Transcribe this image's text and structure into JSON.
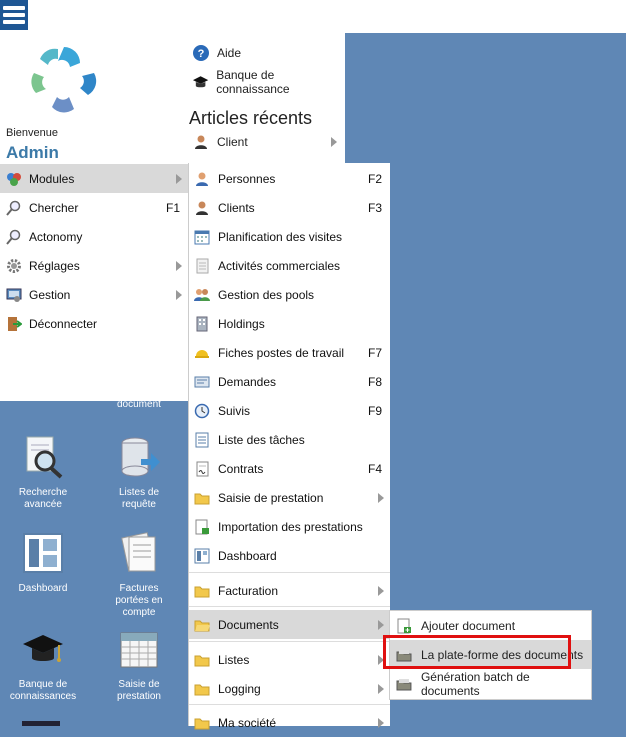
{
  "topbar": {
    "menu_icon": "hamburger-icon"
  },
  "desktop": {
    "partial_label": "document",
    "icons": [
      {
        "label": "Recherche avancée",
        "icon": "magnifier-document-icon"
      },
      {
        "label": "Listes de requête",
        "icon": "database-arrow-icon"
      },
      {
        "label": "Dashboard",
        "icon": "dashboard-icon"
      },
      {
        "label": "Factures portées en compte",
        "icon": "invoice-icon"
      },
      {
        "label": "Banque de connaissances",
        "icon": "graduation-cap-icon"
      },
      {
        "label": "Saisie de prestation",
        "icon": "calendar-icon"
      }
    ]
  },
  "main_menu": {
    "welcome": "Bienvenue",
    "user": "Admin",
    "help_label": "Aide",
    "knowledge_label": "Banque de connaissance",
    "recent_title": "Articles récents",
    "recent_items": [
      {
        "label": "Client"
      }
    ],
    "items": [
      {
        "label": "Modules",
        "icon": "modules-icon",
        "shortcut": "",
        "has_sub": true,
        "selected": true
      },
      {
        "label": "Chercher",
        "icon": "search-icon",
        "shortcut": "F1",
        "has_sub": false
      },
      {
        "label": "Actonomy",
        "icon": "search-icon",
        "shortcut": "",
        "has_sub": false
      },
      {
        "label": "Réglages",
        "icon": "gear-icon",
        "shortcut": "",
        "has_sub": true
      },
      {
        "label": "Gestion",
        "icon": "management-icon",
        "shortcut": "",
        "has_sub": true
      },
      {
        "label": "Déconnecter",
        "icon": "logout-icon",
        "shortcut": "",
        "has_sub": false
      }
    ]
  },
  "modules_menu": {
    "items": [
      {
        "label": "Personnes",
        "shortcut": "F2",
        "icon": "person-icon"
      },
      {
        "label": "Clients",
        "shortcut": "F3",
        "icon": "client-icon"
      },
      {
        "label": "Planification des visites",
        "shortcut": "",
        "icon": "calendar-icon"
      },
      {
        "label": "Activités commerciales",
        "shortcut": "",
        "icon": "document-icon"
      },
      {
        "label": "Gestion des pools",
        "shortcut": "",
        "icon": "group-icon"
      },
      {
        "label": "Holdings",
        "shortcut": "",
        "icon": "building-icon"
      },
      {
        "label": "Fiches postes de travail",
        "shortcut": "F7",
        "icon": "hardhat-icon"
      },
      {
        "label": "Demandes",
        "shortcut": "F8",
        "icon": "request-icon"
      },
      {
        "label": "Suivis",
        "shortcut": "F9",
        "icon": "clock-icon"
      },
      {
        "label": "Liste des tâches",
        "shortcut": "",
        "icon": "task-list-icon"
      },
      {
        "label": "Contrats",
        "shortcut": "F4",
        "icon": "contract-icon"
      },
      {
        "label": "Saisie de prestation",
        "shortcut": "",
        "icon": "folder-icon"
      },
      {
        "label": "Importation des prestations",
        "shortcut": "",
        "icon": "import-icon"
      },
      {
        "label": "Dashboard",
        "shortcut": "",
        "icon": "dashboard-icon"
      },
      {
        "label": "Facturation",
        "shortcut": "",
        "icon": "folder-icon"
      },
      {
        "label": "Documents",
        "shortcut": "",
        "icon": "folder-icon"
      },
      {
        "label": "Listes",
        "shortcut": "",
        "icon": "folder-icon"
      },
      {
        "label": "Logging",
        "shortcut": "",
        "icon": "folder-icon"
      },
      {
        "label": "Ma société",
        "shortcut": "",
        "icon": "folder-icon"
      }
    ]
  },
  "documents_menu": {
    "items": [
      {
        "label": "Ajouter document",
        "icon": "add-document-icon"
      },
      {
        "label": "La plate-forme des documents",
        "icon": "documents-platform-icon"
      },
      {
        "label": "Génération batch de documents",
        "icon": "batch-documents-icon"
      }
    ]
  },
  "colors": {
    "desktop_bg": "#5f87b5",
    "accent": "#1f5794",
    "admin": "#3c7aa8",
    "highlight": "#e01010",
    "selected_bg": "#d9d9d9"
  }
}
